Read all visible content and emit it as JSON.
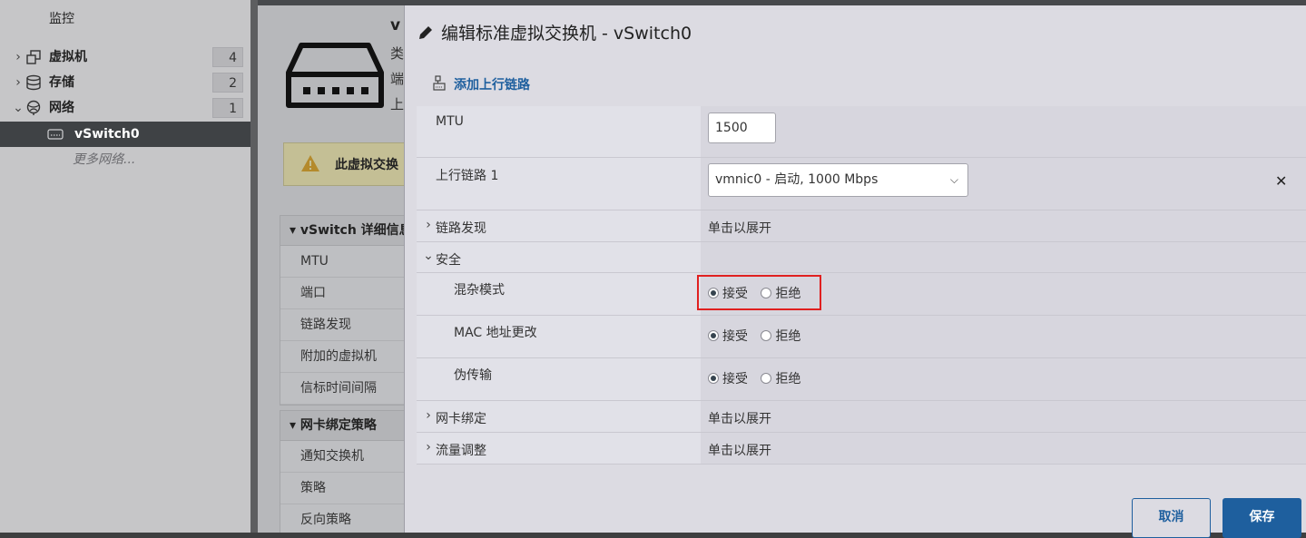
{
  "nav": {
    "monitor": "监控",
    "vms": {
      "label": "虚拟机",
      "count": "4"
    },
    "storage": {
      "label": "存储",
      "count": "2"
    },
    "network": {
      "label": "网络",
      "count": "1"
    },
    "vswitch": "vSwitch0",
    "more_networks": "更多网络..."
  },
  "background": {
    "title_partial": "v",
    "lines_partial": [
      "类",
      "端",
      "上"
    ],
    "warning_partial": "此虚拟交换",
    "details_panel": {
      "header": "vSwitch 详细信息",
      "rows": [
        "MTU",
        "端口",
        "链路发现",
        "附加的虚拟机",
        "信标时间间隔"
      ]
    },
    "teaming_panel": {
      "header": "网卡绑定策略",
      "rows": [
        "通知交换机",
        "策略",
        "反向策略"
      ]
    }
  },
  "dialog": {
    "title": "编辑标准虚拟交换机 - vSwitch0",
    "add_uplink": "添加上行链路",
    "mtu": {
      "label": "MTU",
      "value": "1500"
    },
    "uplink1": {
      "label": "上行链路 1",
      "value": "vmnic0 - 启动, 1000 Mbps"
    },
    "link_discovery": {
      "label": "链路发现",
      "value": "单击以展开"
    },
    "security": {
      "label": "安全",
      "promiscuous": {
        "label": "混杂模式",
        "selected": "accept"
      },
      "mac_changes": {
        "label": "MAC 地址更改",
        "selected": "accept"
      },
      "forged_transmits": {
        "label": "伪传输",
        "selected": "accept"
      }
    },
    "accept_label": "接受",
    "reject_label": "拒绝",
    "nic_teaming": {
      "label": "网卡绑定",
      "value": "单击以展开"
    },
    "traffic_shaping": {
      "label": "流量调整",
      "value": "单击以展开"
    },
    "cancel": "取消",
    "save": "保存"
  }
}
